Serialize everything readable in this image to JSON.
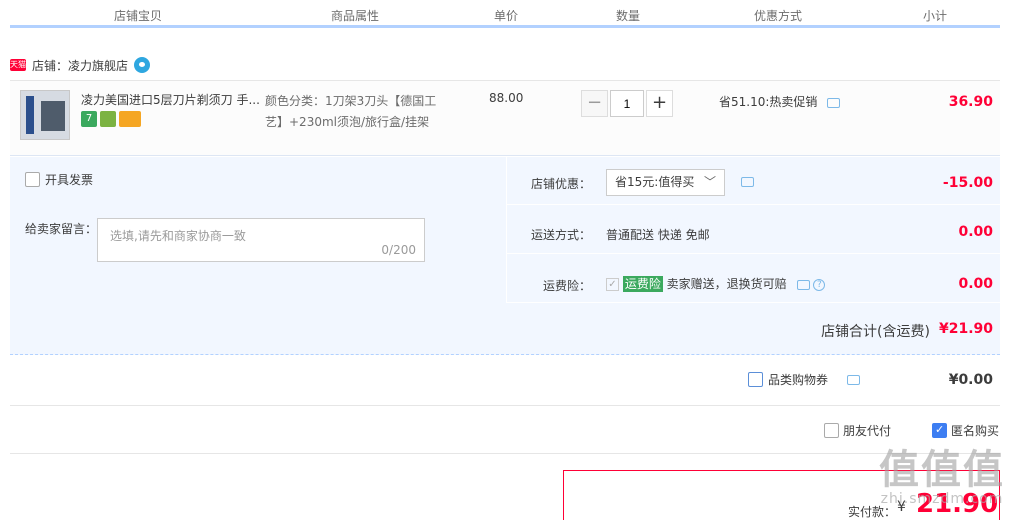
{
  "header": {
    "cols": [
      "店铺宝贝",
      "商品属性",
      "单价",
      "数量",
      "优惠方式",
      "小计"
    ]
  },
  "store": {
    "badge": "天猫",
    "name": "店铺：凌力旗舰店"
  },
  "item": {
    "title": "凌力美国进口5层刀片剃须刀 手...",
    "badges": [
      "7",
      "",
      ""
    ],
    "attr": "颜色分类：1刀架3刀头【德国工艺】+230ml须泡/旅行盒/挂架",
    "price": "88.00",
    "quantity": "1",
    "qty_minus": "−",
    "qty_plus": "+",
    "promo": "省51.10:热卖促销",
    "subtotal": "36.90"
  },
  "options": {
    "invoice_label": "开具发票",
    "message_label": "给卖家留言：",
    "message_placeholder": "选填,请先和商家协商一致",
    "message_counter": "0/200",
    "store_discount_label": "店铺优惠：",
    "store_discount_select": "省15元:值得买",
    "store_discount_amount": "-15.00",
    "shipping_label": "运送方式：",
    "shipping_value": "普通配送 快递 免邮",
    "shipping_amount": "0.00",
    "insurance_label": "运费险：",
    "insurance_tag": "运费险",
    "insurance_text": "卖家赠送，退换货可赔",
    "insurance_amount": "0.00"
  },
  "store_total": {
    "label": "店铺合计(含运费)",
    "amount": "¥21.90"
  },
  "coupon": {
    "label": "品类购物券",
    "amount": "¥0.00"
  },
  "friend": {
    "friend_pay": "朋友代付",
    "anonymous": "匿名购买"
  },
  "payment": {
    "label": "实付款：",
    "currency": "¥",
    "amount": "21.90"
  },
  "watermark": {
    "big": "值值值",
    "small": "zhi.smzdm.com"
  },
  "colors": {
    "accent_red": "#ff0036",
    "header_line": "#b2d1ff",
    "panel_bg": "#f2f7ff",
    "checkbox_blue": "#3d7ef2",
    "insurance_green": "#3ba95e"
  }
}
